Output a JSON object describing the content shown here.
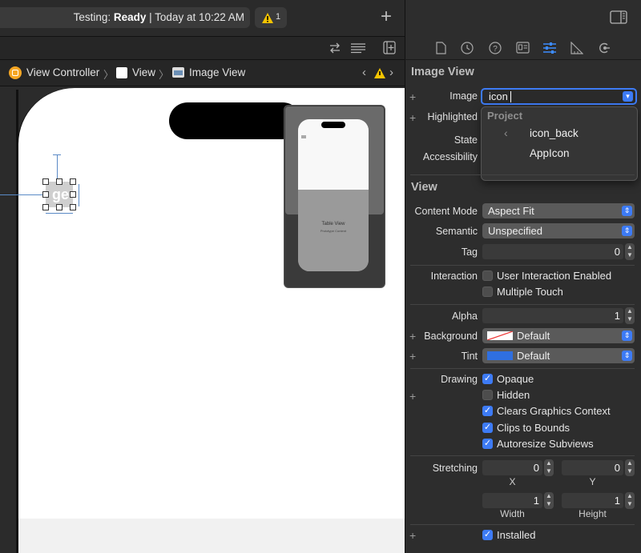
{
  "toolbar": {
    "status_prefix": "Testing: ",
    "status_state": "Ready",
    "status_suffix": " | Today at 10:22 AM",
    "warning_count": "1"
  },
  "jumpbar": {
    "items": [
      "View Controller",
      "View",
      "Image View"
    ]
  },
  "canvas": {
    "minimap_label": "Table View",
    "minimap_sublabel": "Prototype Content"
  },
  "inspector": {
    "image_view_title": "Image View",
    "image_label": "Image",
    "image_value": "icon",
    "highlighted_label": "Highlighted",
    "state_label": "State",
    "accessibility_label": "Accessibility",
    "dropdown": {
      "group": "Project",
      "items": [
        "icon_back",
        "AppIcon"
      ]
    },
    "view_title": "View",
    "content_mode_label": "Content Mode",
    "content_mode_value": "Aspect Fit",
    "semantic_label": "Semantic",
    "semantic_value": "Unspecified",
    "tag_label": "Tag",
    "tag_value": "0",
    "interaction_label": "Interaction",
    "user_interaction": "User Interaction Enabled",
    "multiple_touch": "Multiple Touch",
    "alpha_label": "Alpha",
    "alpha_value": "1",
    "background_label": "Background",
    "background_value": "Default",
    "tint_label": "Tint",
    "tint_value": "Default",
    "tint_color": "#2f6fe0",
    "drawing_label": "Drawing",
    "opaque": "Opaque",
    "hidden": "Hidden",
    "clears_graphics": "Clears Graphics Context",
    "clips_to_bounds": "Clips to Bounds",
    "autoresize": "Autoresize Subviews",
    "stretching_label": "Stretching",
    "stretch_x": "0",
    "stretch_y": "0",
    "stretch_width": "1",
    "stretch_height": "1",
    "x_label": "X",
    "y_label": "Y",
    "width_label": "Width",
    "height_label": "Height",
    "installed": "Installed"
  }
}
